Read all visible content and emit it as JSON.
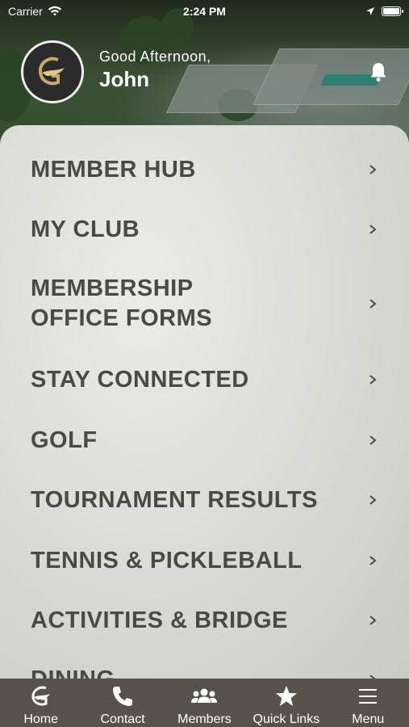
{
  "status_bar": {
    "carrier": "Carrier",
    "time": "2:24 PM",
    "battery_level": 1.0
  },
  "header": {
    "greeting": "Good Afternoon,",
    "name": "John",
    "logo_icon": "club-logo-icon",
    "bell_icon": "bell-icon"
  },
  "menu": {
    "items": [
      {
        "label": "MEMBER HUB"
      },
      {
        "label": "MY CLUB"
      },
      {
        "label": "MEMBERSHIP OFFICE FORMS"
      },
      {
        "label": "STAY CONNECTED"
      },
      {
        "label": "GOLF"
      },
      {
        "label": "TOURNAMENT RESULTS"
      },
      {
        "label": "TENNIS & PICKLEBALL"
      },
      {
        "label": "ACTIVITIES & BRIDGE"
      },
      {
        "label": "DINING"
      }
    ]
  },
  "tabbar": {
    "tabs": [
      {
        "label": "Home",
        "icon": "club-logo-icon"
      },
      {
        "label": "Contact",
        "icon": "phone-icon"
      },
      {
        "label": "Members",
        "icon": "group-icon"
      },
      {
        "label": "Quick Links",
        "icon": "star-icon"
      },
      {
        "label": "Menu",
        "icon": "hamburger-icon"
      }
    ]
  },
  "colors": {
    "tabbar_bg": "#57534c",
    "menu_text": "#4a4a45",
    "panel_bg": "#dcddd8"
  }
}
